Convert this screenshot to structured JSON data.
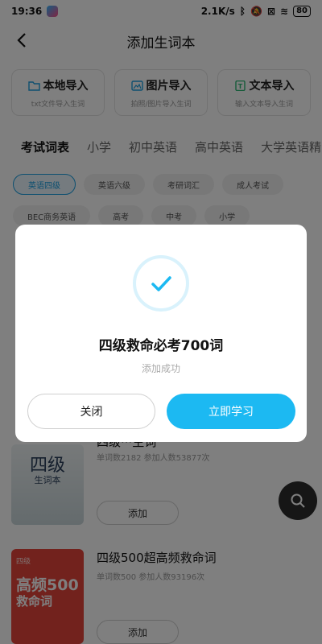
{
  "status": {
    "time": "19:36",
    "speed": "2.1K/s",
    "battery": "80"
  },
  "header": {
    "title": "添加生词本"
  },
  "imports": [
    {
      "label": "本地导入",
      "sub": "txt文件导入生词",
      "icon": "folder-icon"
    },
    {
      "label": "图片导入",
      "sub": "拍照/图片导入生词",
      "icon": "image-icon"
    },
    {
      "label": "文本导入",
      "sub": "输入文本导入生词",
      "icon": "text-icon"
    }
  ],
  "tabs": [
    "考试词表",
    "小学",
    "初中英语",
    "高中英语",
    "大学英语精"
  ],
  "chips_row1": [
    "英语四级",
    "英语六级",
    "考研词汇",
    "成人考试"
  ],
  "chips_row2": [
    "BEC商务英语",
    "高考",
    "中考",
    "小学"
  ],
  "books": [
    {
      "title": "四级···生词",
      "meta": "单词数2182   参加人数53877次",
      "add": "添加",
      "cover_big": "四级",
      "cover_small": "生词本"
    },
    {
      "title": "四级500超高频救命词",
      "meta": "单词数500   参加人数93196次",
      "add": "添加",
      "cover_tag": "四级",
      "cover_big": "高频500",
      "cover_mid": "救命词"
    }
  ],
  "dialog": {
    "title": "四级救命必考700词",
    "subtitle": "添加成功",
    "close": "关闭",
    "study": "立即学习"
  },
  "colors": {
    "accent": "#1cb9f2",
    "chip_active": "#1a9fe0",
    "cover_red": "#e5453b"
  }
}
